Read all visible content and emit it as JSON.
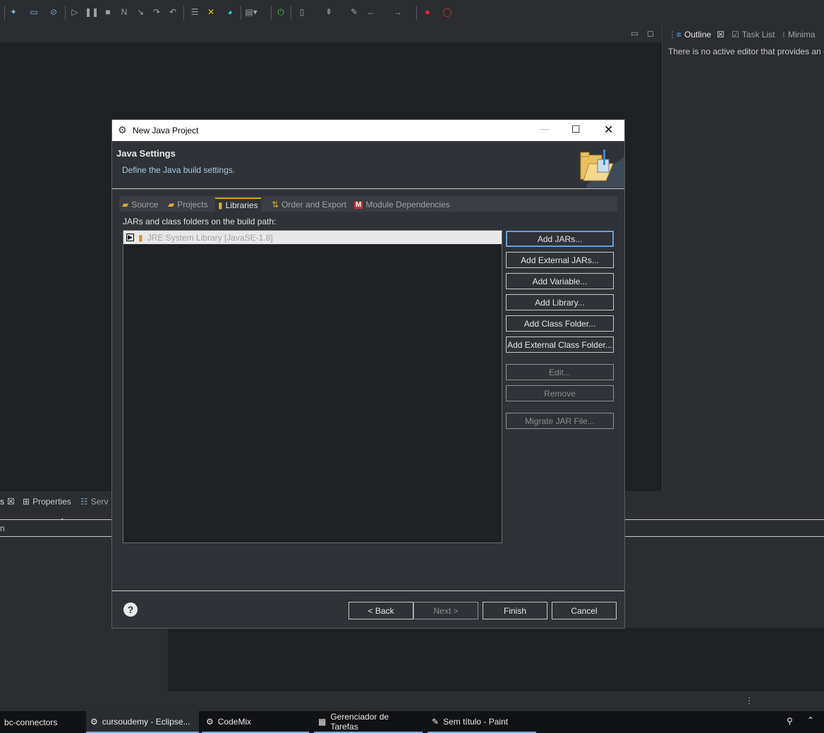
{
  "outline": {
    "tabs": [
      {
        "label": "Outline",
        "active": true
      },
      {
        "label": "Task List"
      },
      {
        "label": "Minima"
      }
    ],
    "message": "There is no active editor that provides an o"
  },
  "bottom": {
    "tabs": [
      {
        "label": "s"
      },
      {
        "label": "Properties"
      },
      {
        "label": "Serv"
      }
    ],
    "row_label": "n"
  },
  "dialog": {
    "title": "New Java Project",
    "heading": "Java Settings",
    "subheading": "Define the Java build settings.",
    "tabs": [
      "Source",
      "Projects",
      "Libraries",
      "Order and Export",
      "Module Dependencies"
    ],
    "active_tab": "Libraries",
    "list_label": "JARs and class folders on the build path:",
    "list_items": [
      "JRE System Library [JavaSE-1.8]"
    ],
    "buttons": {
      "add_jars": "Add JARs...",
      "add_external_jars": "Add External JARs...",
      "add_variable": "Add Variable...",
      "add_library": "Add Library...",
      "add_class_folder": "Add Class Folder...",
      "add_external_class_folder": "Add External Class Folder...",
      "edit": "Edit...",
      "remove": "Remove",
      "migrate_jar": "Migrate JAR File..."
    },
    "footer": {
      "back": "< Back",
      "next": "Next >",
      "finish": "Finish",
      "cancel": "Cancel"
    }
  },
  "taskbar": {
    "items": [
      {
        "label": "bc-connectors"
      },
      {
        "label": "cursoudemy - Eclipse..."
      },
      {
        "label": "CodeMix"
      },
      {
        "label": "Gerenciador de Tarefas"
      },
      {
        "label": "Sem título - Paint"
      }
    ]
  },
  "colors": {
    "accent_tab": "#d4a020",
    "focus": "#6aa0d8",
    "background": "#1f2124",
    "panel": "#2b2d30"
  }
}
